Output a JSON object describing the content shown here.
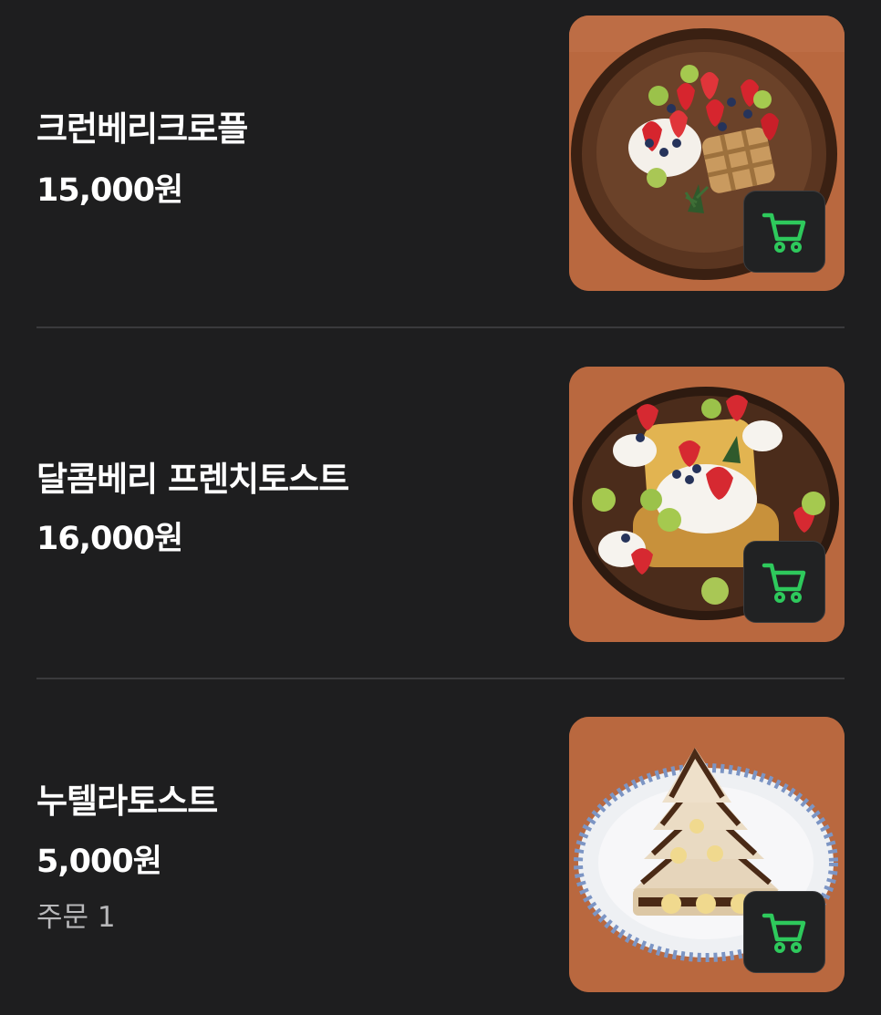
{
  "menu": {
    "items": [
      {
        "name": "크런베리크로플",
        "price": "15,000원",
        "photo": "croffle-photo",
        "cart_icon": "cart-icon"
      },
      {
        "name": "달콤베리 프렌치토스트",
        "price": "16,000원",
        "photo": "french-toast-photo",
        "cart_icon": "cart-icon"
      },
      {
        "name": "누텔라토스트",
        "price": "5,000원",
        "order_count": "주문 1",
        "photo": "nutella-toast-photo",
        "cart_icon": "cart-icon"
      }
    ]
  },
  "colors": {
    "background": "#1e1e1f",
    "text": "#ffffff",
    "muted_text": "#b8b8ba",
    "divider": "#3a3a3c",
    "cart_accent": "#2ec95c",
    "cart_button_bg": "#212223",
    "table_wood": "#b7683f"
  }
}
